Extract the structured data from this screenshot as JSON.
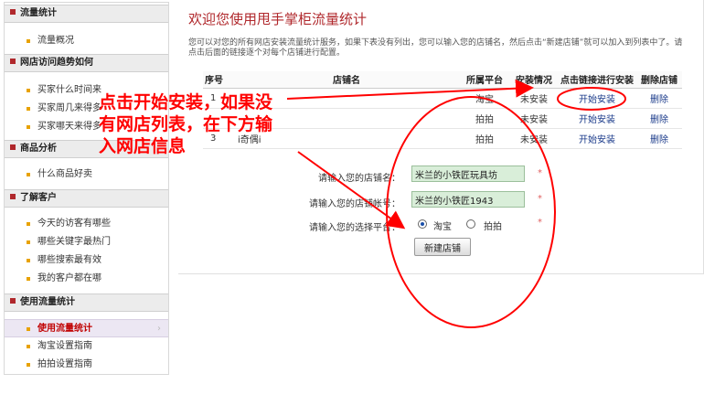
{
  "sidebar": {
    "sections": [
      {
        "title": "流量统计",
        "items": [
          "流量概况"
        ]
      },
      {
        "title": "网店访问趋势如何",
        "items": [
          "买家什么时间来",
          "买家周几来得多",
          "买家哪天来得多"
        ]
      },
      {
        "title": "商品分析",
        "items": [
          "什么商品好卖"
        ]
      },
      {
        "title": "了解客户",
        "items": [
          "今天的访客有哪些",
          "哪些关键字最热门",
          "哪些搜索最有效",
          "我的客户都在哪"
        ]
      },
      {
        "title": "使用流量统计",
        "items": [
          "使用流量统计",
          "淘宝设置指南",
          "拍拍设置指南"
        ]
      }
    ],
    "active_item": "使用流量统计"
  },
  "main": {
    "title": "欢迎您使用甩手掌柜流量统计",
    "intro": "您可以对您的所有网店安装流量统计服务，如果下表没有列出，您可以输入您的店铺名，然后点击“新建店铺”就可以加入到列表中了。请点击后面的链接逐个对每个店铺进行配置。",
    "table": {
      "headers": [
        "序号",
        "店铺名",
        "所属平台",
        "安装情况",
        "点击链接进行安装",
        "删除店铺"
      ],
      "rows": [
        {
          "no": "1",
          "shop": "",
          "platform": "淘宝",
          "status": "未安装",
          "action": "开始安装",
          "delete": "删除"
        },
        {
          "no": "",
          "shop": "",
          "platform": "拍拍",
          "status": "未安装",
          "action": "开始安装",
          "delete": "删除"
        },
        {
          "no": "3",
          "shop": "i奇偶i",
          "platform": "拍拍",
          "status": "未安装",
          "action": "开始安装",
          "delete": "删除"
        }
      ]
    },
    "form": {
      "shop_name_label": "请输入您的店铺名：",
      "shop_name_value": "米兰的小铁匠玩具坊",
      "shop_account_label": "请输入您的店铺帐号：",
      "shop_account_value": "米兰的小铁匠1943",
      "platform_label": "请输入您的选择平台：",
      "platform_options": [
        "淘宝",
        "拍拍"
      ],
      "platform_selected": "淘宝",
      "required_mark": "*",
      "submit_label": "新建店铺"
    }
  },
  "annotation": {
    "lines": [
      "点击开始安装，如果没",
      "有网店列表，在下方输",
      "入网店信息"
    ],
    "color": "#ff0000"
  }
}
